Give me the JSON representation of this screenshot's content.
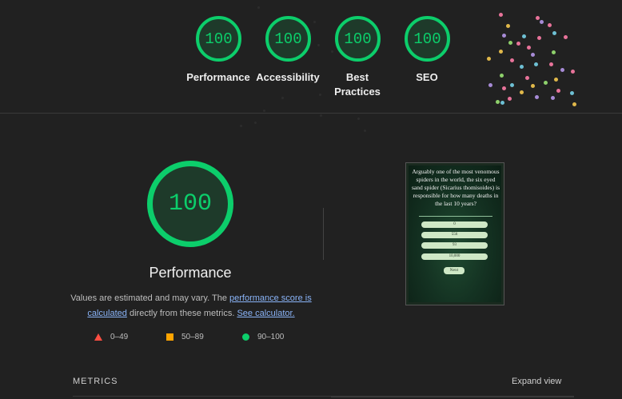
{
  "categories": [
    {
      "label": "Performance",
      "score": "100"
    },
    {
      "label": "Accessibility",
      "score": "100"
    },
    {
      "label": "Best Practices",
      "score": "100"
    },
    {
      "label": "SEO",
      "score": "100"
    }
  ],
  "main": {
    "score": "100",
    "title": "Performance",
    "desc_prefix": "Values are estimated and may vary. The ",
    "link_score": "performance score is calculated",
    "desc_middle": " directly from these metrics. ",
    "link_calc": "See calculator.",
    "legend": [
      {
        "shape": "triangle",
        "range": "0–49",
        "color": "#ff4e42"
      },
      {
        "shape": "square",
        "range": "50–89",
        "color": "#ffa400"
      },
      {
        "shape": "circle",
        "range": "90–100",
        "color": "#0cce6b"
      }
    ]
  },
  "screenshot": {
    "question": "Arguably one of the most venomous spiders in the world, the six eyed sand spider (Sicarius thomisoides) is responsible for how many deaths in the last 10 years?",
    "options": [
      "0",
      "556",
      "93",
      "10,000"
    ],
    "next_label": "Next"
  },
  "metrics_section": {
    "heading": "METRICS",
    "expand_label": "Expand view"
  },
  "colors": {
    "pass": "#0cce6b",
    "average": "#ffa400",
    "fail": "#ff4e42",
    "background": "#212121"
  }
}
